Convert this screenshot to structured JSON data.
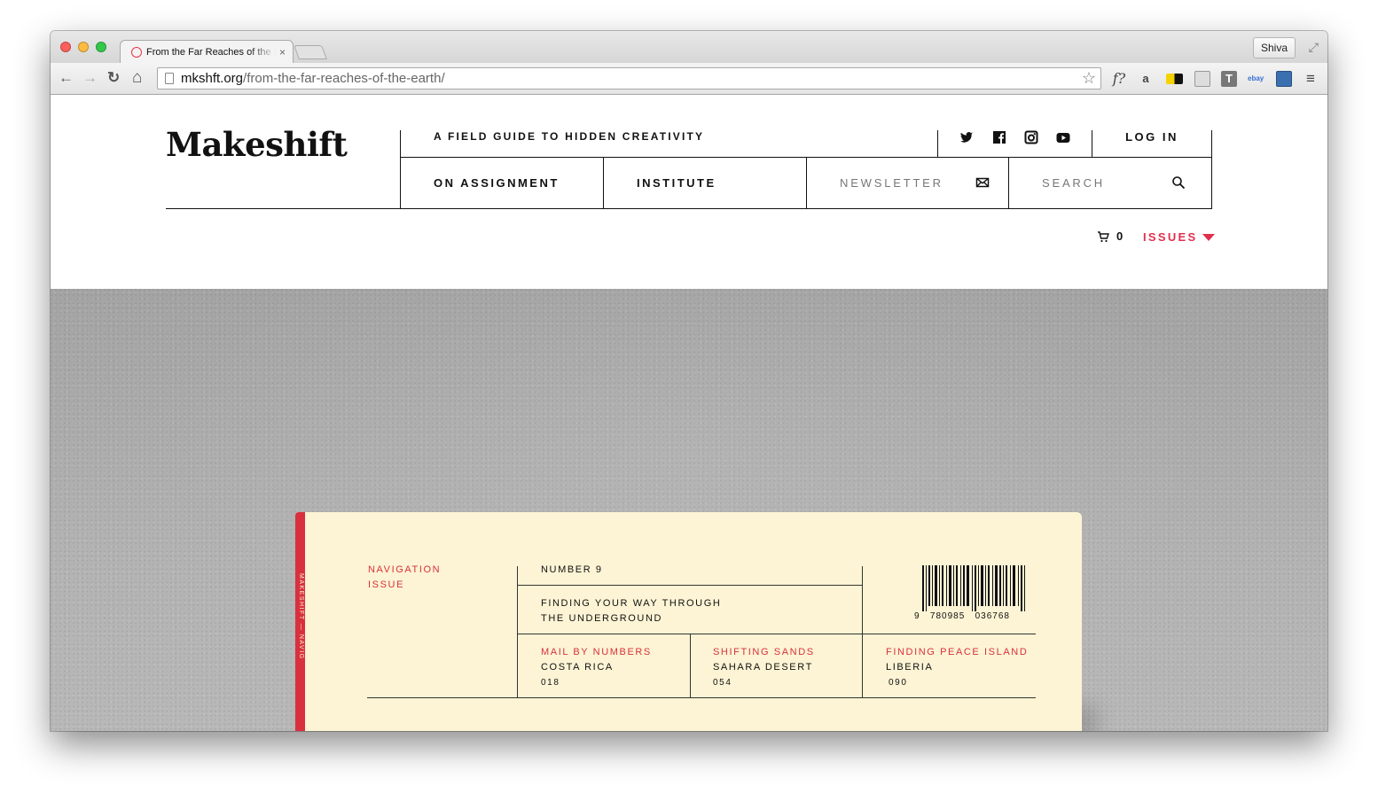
{
  "browser": {
    "tab_title": "From the Far Reaches of the Earth",
    "tab_close": "×",
    "profile": "Shiva",
    "url_domain": "mkshft.org",
    "url_path": "/from-the-far-reaches-of-the-earth/",
    "nav": {
      "back": "←",
      "forward": "→",
      "reload": "↻",
      "home": "⌂"
    },
    "star": "☆",
    "extensions": [
      "f?",
      "a"
    ]
  },
  "site": {
    "logo": "Makeshift",
    "tagline": "A FIELD GUIDE TO HIDDEN CREATIVITY",
    "login": "LOG IN",
    "nav": [
      "ON ASSIGNMENT",
      "INSTITUTE"
    ],
    "newsletter": "NEWSLETTER",
    "search": "SEARCH",
    "cart_count": "0",
    "issues": "ISSUES",
    "social": [
      "twitter-icon",
      "facebook-icon",
      "instagram-icon",
      "youtube-icon"
    ],
    "accent": "#e0304e"
  },
  "book": {
    "issue_line1": "NAVIGATION",
    "issue_line2": "ISSUE",
    "number": "NUMBER 9",
    "feature_line1": "FINDING YOUR WAY THROUGH",
    "feature_line2": "THE UNDERGROUND",
    "barcode_digits": "9   780985   036768",
    "spine": "MAKESHIFT — NAVIG",
    "stories": [
      {
        "title": "MAIL BY NUMBERS",
        "place": "COSTA RICA",
        "page": "018"
      },
      {
        "title": "SHIFTING SANDS",
        "place": "SAHARA DESERT",
        "page": "054"
      },
      {
        "title": "FINDING PEACE ISLAND",
        "place": "LIBERIA",
        "page": "090"
      }
    ],
    "cover_color": "#fcf4d4",
    "spine_color": "#d9303e"
  }
}
